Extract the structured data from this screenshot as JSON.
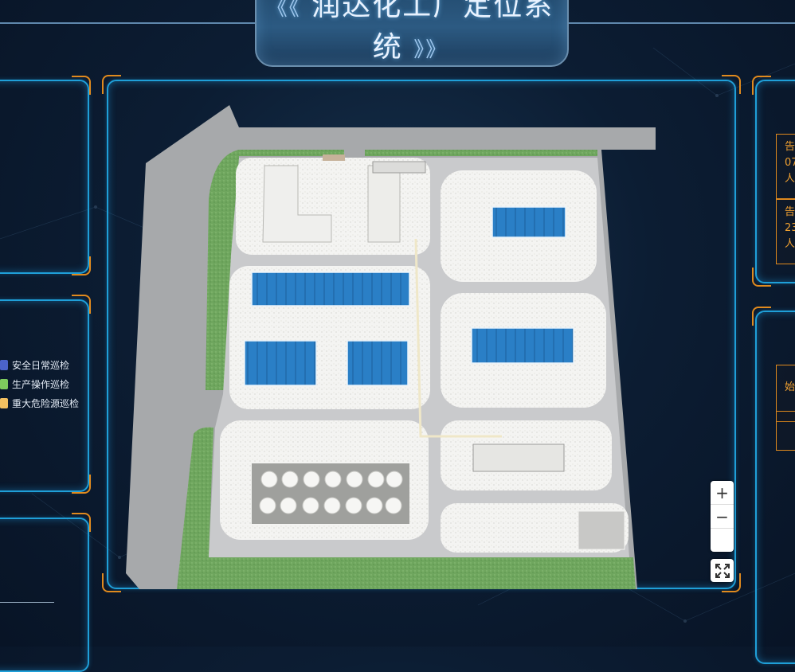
{
  "header": {
    "title": "润达化工厂定位系统",
    "deco_left": "《《",
    "deco_right": "》》"
  },
  "legend": {
    "items": [
      {
        "label": "安全日常巡检",
        "color": "#4b63c9"
      },
      {
        "label": "生产操作巡检",
        "color": "#7ecb5e"
      },
      {
        "label": "重大危险源巡检",
        "color": "#f2c061"
      }
    ]
  },
  "alerts": {
    "cards": [
      {
        "line1": "告",
        "line2": "07",
        "line3": "人"
      },
      {
        "line1": "告",
        "line2": "23",
        "line3": "人"
      }
    ],
    "status_cards": [
      {
        "line1": "始"
      },
      {
        "line1": ""
      }
    ]
  },
  "map_controls": {
    "zoom_in": "+",
    "zoom_out": "−"
  },
  "colors": {
    "panel_border": "#1f9fd8",
    "corner_accent": "#e08a1e",
    "roof_blue": "#2a7fc6",
    "grass": "#6aa05a",
    "road": "#a7a9ab"
  }
}
